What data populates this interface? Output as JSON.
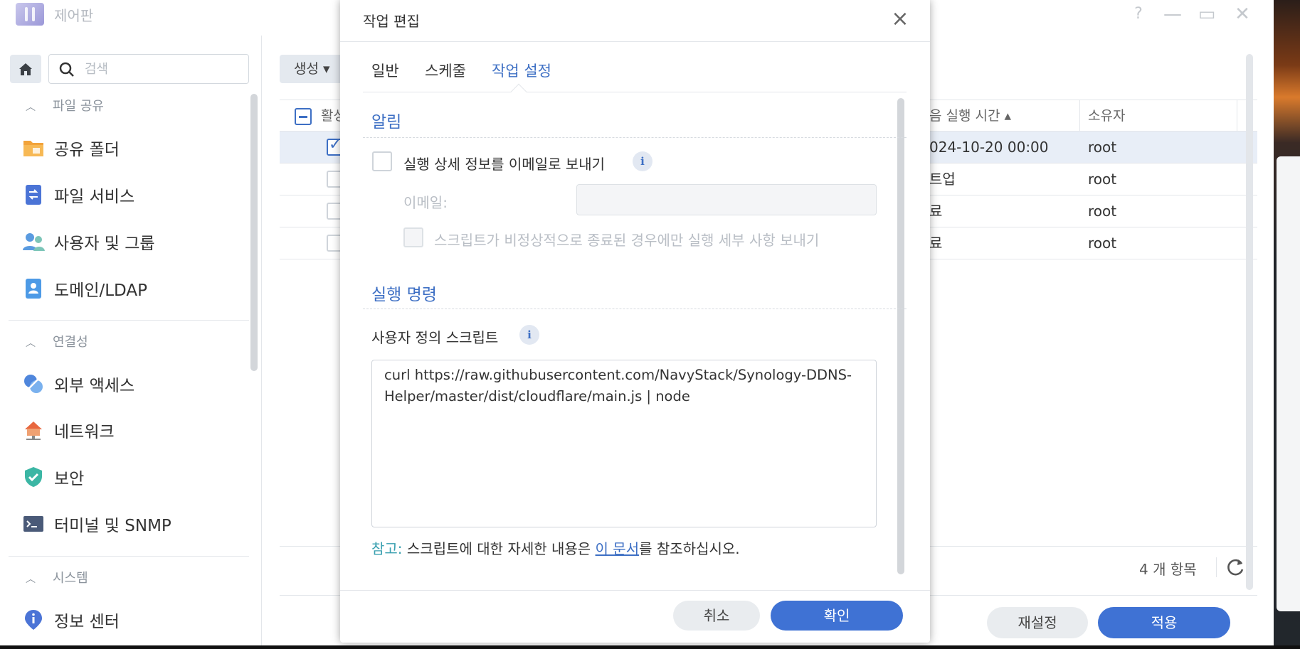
{
  "window": {
    "title": "제어판",
    "controls": [
      "?",
      "—",
      "▭",
      "✕"
    ]
  },
  "sidebar": {
    "search_placeholder": "검색",
    "sections": [
      {
        "label": "파일 공유",
        "items": [
          {
            "label": "공유 폴더",
            "icon": "shared-folder-icon"
          },
          {
            "label": "파일 서비스",
            "icon": "file-services-icon"
          },
          {
            "label": "사용자 및 그룹",
            "icon": "user-group-icon"
          },
          {
            "label": "도메인/LDAP",
            "icon": "domain-ldap-icon"
          }
        ]
      },
      {
        "label": "연결성",
        "items": [
          {
            "label": "외부 액세스",
            "icon": "external-access-icon"
          },
          {
            "label": "네트워크",
            "icon": "network-icon"
          },
          {
            "label": "보안",
            "icon": "security-shield-icon"
          },
          {
            "label": "터미널 및 SNMP",
            "icon": "terminal-icon"
          }
        ]
      },
      {
        "label": "시스템",
        "items": [
          {
            "label": "정보 센터",
            "icon": "info-center-icon"
          }
        ]
      }
    ]
  },
  "content": {
    "create_label": "생성 ▾",
    "columns": {
      "active": "활성",
      "next_run": "음 실행 시간 ▴",
      "owner": "소유자"
    },
    "rows": [
      {
        "next_run": "024-10-20 00:00",
        "owner": "root",
        "selected": true
      },
      {
        "next_run": "트업",
        "owner": "root",
        "selected": false
      },
      {
        "next_run": "료",
        "owner": "root",
        "selected": false
      },
      {
        "next_run": "료",
        "owner": "root",
        "selected": false
      }
    ],
    "item_count": "4 개 항목",
    "reset_label": "재설정",
    "apply_label": "적용"
  },
  "dialog": {
    "title": "작업 편집",
    "tabs": [
      "일반",
      "스케줄",
      "작업 설정"
    ],
    "active_tab": "작업 설정",
    "notification": {
      "title": "알림",
      "send_email_label": "실행 상세 정보를 이메일로 보내기",
      "email_label": "이메일:",
      "email_value": "",
      "abnormal_only_label": "스크립트가 비정상적으로 종료된 경우에만 실행 세부 사항 보내기"
    },
    "command": {
      "title": "실행 명령",
      "script_label": "사용자 정의 스크립트",
      "script_value": "curl https://raw.githubusercontent.com/NavyStack/Synology-DDNS-Helper/master/dist/cloudflare/main.js | node"
    },
    "note": {
      "prefix": "참고:",
      "text_before": " 스크립트에 대한 자세한 내용은 ",
      "link_text": "이 문서",
      "text_after": "를 참조하십시오."
    },
    "cancel_label": "취소",
    "ok_label": "확인"
  },
  "colors": {
    "accent": "#3f72d4",
    "link": "#3d6fc4",
    "note_key": "#3aa0b0"
  }
}
